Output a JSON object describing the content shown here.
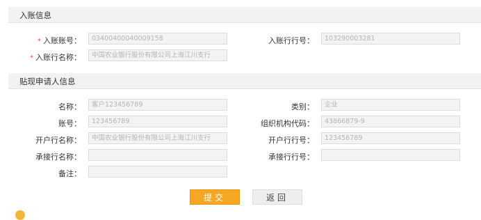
{
  "section1": {
    "title": "入账信息",
    "account_no_label": "入账账号：",
    "account_no_value": "03400400040009158",
    "bank_no_label": "入账行行号：",
    "bank_no_value": "103290003281",
    "bank_name_label": "入账行名称：",
    "bank_name_value": "中国农业银行股份有限公司上海江川支行"
  },
  "section2": {
    "title": "贴现申请人信息",
    "name_label": "名称：",
    "name_value": "客户123456789",
    "category_label": "类别：",
    "category_value": "企业",
    "account_label": "账号：",
    "account_value": "123456789",
    "org_code_label": "组织机构代码：",
    "org_code_value": "43866879-9",
    "open_bank_name_label": "开户行名称：",
    "open_bank_name_value": "中国农业银行股份有限公司上海江川支行",
    "open_bank_no_label": "开户行行号：",
    "open_bank_no_value": "123456789",
    "accept_bank_name_label": "承接行名称：",
    "accept_bank_name_value": "",
    "accept_bank_no_label": "承接行行号：",
    "accept_bank_no_value": "",
    "remark_label": "备注：",
    "remark_value": ""
  },
  "buttons": {
    "submit": "提交",
    "back": "返回"
  }
}
